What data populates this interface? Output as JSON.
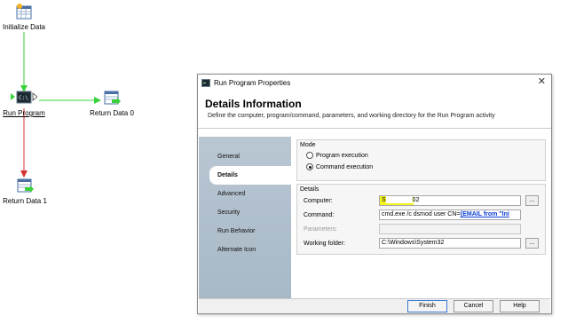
{
  "workflow": {
    "nodes": [
      {
        "label": "Initialize Data",
        "icon": "initialize-data-icon"
      },
      {
        "label": "Run Program",
        "icon": "run-program-icon"
      },
      {
        "label": "Return Data 0",
        "icon": "return-data-icon"
      },
      {
        "label": "Return Data 1",
        "icon": "return-data-icon"
      }
    ],
    "colors": {
      "success_wire": "#39d13a",
      "failure_wire": "#d63131"
    }
  },
  "dialog": {
    "title": "Run Program Properties",
    "close_glyph": "✕",
    "header_title": "Details Information",
    "header_subtitle": "Define the computer, program/command, parameters, and working directory for the Run Program activity",
    "nav": [
      "General",
      "Details",
      "Advanced",
      "Security",
      "Run Behavior",
      "Alternate Icon"
    ],
    "active_nav": "Details",
    "mode": {
      "label": "Mode",
      "options": [
        "Program execution",
        "Command execution"
      ],
      "selected": "Command execution"
    },
    "details": {
      "label": "Details",
      "computer_label": "Computer:",
      "computer_value_start": "S",
      "computer_value_end": "02",
      "command_label": "Command:",
      "command_value": "cmd.exe /c dsmod user CN=",
      "command_link": "{EMAIL from \"Ini",
      "parameters_label": "Parameters:",
      "parameters_value": "",
      "working_folder_label": "Working folder:",
      "working_folder_value": "C:\\Windows\\System32",
      "browse_label": "..."
    },
    "buttons": {
      "finish": "Finish",
      "cancel": "Cancel",
      "help": "Help"
    },
    "colors": {
      "highlight": "#f5f523",
      "link": "#0b3dd1",
      "nav_bg": "#b1c0cd"
    }
  }
}
